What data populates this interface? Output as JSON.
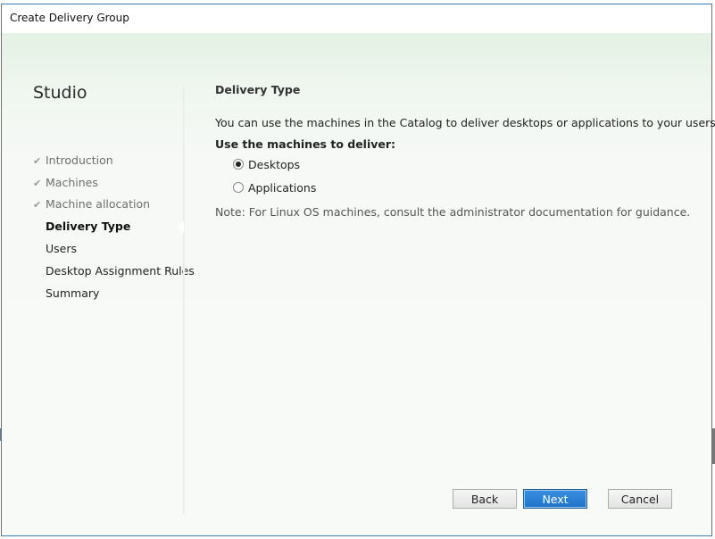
{
  "window": {
    "title": "Create Delivery Group"
  },
  "sidebar": {
    "brand": "Studio",
    "items": [
      {
        "label": "Introduction",
        "state": "done"
      },
      {
        "label": "Machines",
        "state": "done"
      },
      {
        "label": "Machine allocation",
        "state": "done"
      },
      {
        "label": "Delivery Type",
        "state": "current"
      },
      {
        "label": "Users",
        "state": "pending"
      },
      {
        "label": "Desktop Assignment Rules",
        "state": "pending"
      },
      {
        "label": "Summary",
        "state": "pending"
      }
    ]
  },
  "main": {
    "title": "Delivery Type",
    "description": "You can use the machines in the Catalog to deliver desktops or applications to your users.",
    "use_label": "Use the machines to deliver:",
    "options": [
      {
        "label": "Desktops",
        "checked": true
      },
      {
        "label": "Applications",
        "checked": false
      }
    ],
    "note": "Note: For Linux OS machines, consult the administrator documentation for guidance."
  },
  "footer": {
    "back_label": "Back",
    "next_label": "Next",
    "cancel_label": "Cancel"
  },
  "icons": {
    "check": "check-icon"
  },
  "colors": {
    "accent": "#1f74c8",
    "panel_bg": "#e4f1e4"
  }
}
